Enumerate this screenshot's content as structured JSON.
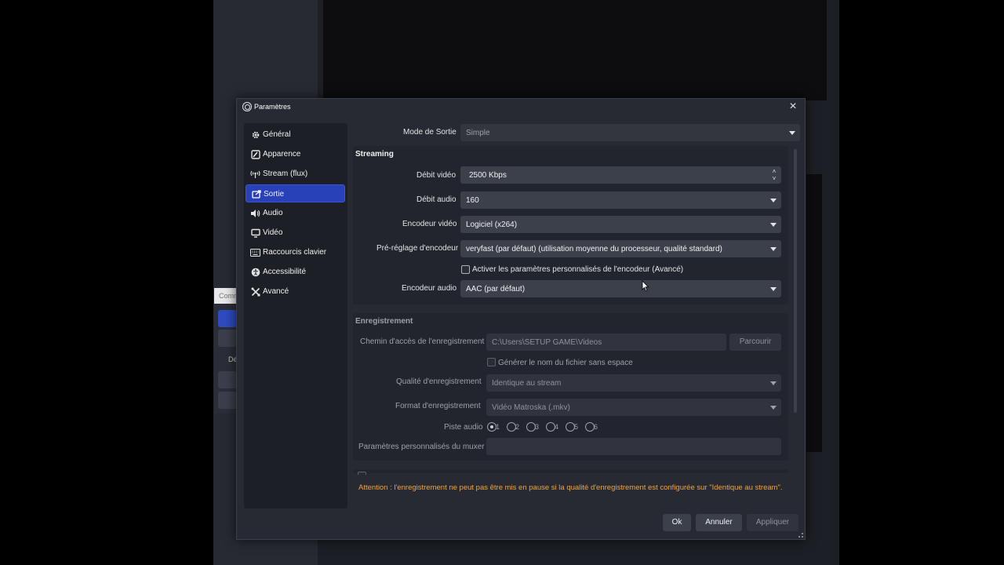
{
  "background": {
    "dock_tab_label": "Comr",
    "dock_label": "Dé"
  },
  "dialog": {
    "title": "Paramètres",
    "close_glyph": "×"
  },
  "sidebar": {
    "items": [
      {
        "label": "Général",
        "icon": "gear-icon"
      },
      {
        "label": "Apparence",
        "icon": "palette-icon"
      },
      {
        "label": "Stream (flux)",
        "icon": "broadcast-icon"
      },
      {
        "label": "Sortie",
        "icon": "output-icon",
        "active": true
      },
      {
        "label": "Audio",
        "icon": "speaker-icon"
      },
      {
        "label": "Vidéo",
        "icon": "monitor-icon"
      },
      {
        "label": "Raccourcis clavier",
        "icon": "keyboard-icon"
      },
      {
        "label": "Accessibilité",
        "icon": "accessibility-icon"
      },
      {
        "label": "Avancé",
        "icon": "tools-icon"
      }
    ]
  },
  "output": {
    "mode_label": "Mode de Sortie",
    "mode_value": "Simple",
    "streaming": {
      "title": "Streaming",
      "video_bitrate_label": "Débit vidéo",
      "video_bitrate_value": "2500 Kbps",
      "audio_bitrate_label": "Débit audio",
      "audio_bitrate_value": "160",
      "video_encoder_label": "Encodeur vidéo",
      "video_encoder_value": "Logiciel (x264)",
      "encoder_preset_label": "Pré-réglage d'encodeur",
      "encoder_preset_value": "veryfast (par défaut) (utilisation moyenne du processeur, qualité standard)",
      "custom_settings_label": "Activer les paramètres personnalisés de l'encodeur (Avancé)",
      "custom_settings_checked": false,
      "audio_encoder_label": "Encodeur audio",
      "audio_encoder_value": "AAC (par défaut)"
    },
    "recording": {
      "title": "Enregistrement",
      "path_label": "Chemin d'accès de l'enregistrement",
      "path_value": "C:\\Users\\SETUP GAME\\Videos",
      "browse_label": "Parcourir",
      "no_space_label": "Générer le nom du fichier sans espace",
      "no_space_checked": false,
      "quality_label": "Qualité d'enregistrement",
      "quality_value": "Identique au stream",
      "format_label": "Format d'enregistrement",
      "format_value": "Vidéo Matroska (.mkv)",
      "audio_track_label": "Piste audio",
      "audio_tracks": [
        "1",
        "2",
        "3",
        "4",
        "5",
        "6"
      ],
      "audio_track_selected": "1",
      "muxer_label": "Paramètres personnalisés du muxer",
      "muxer_value": ""
    },
    "warning": "Attention : l'enregistrement ne peut pas être mis en pause si la qualité d'enregistrement est configurée sur \"Identique au stream\"."
  },
  "buttons": {
    "ok": "Ok",
    "cancel": "Annuler",
    "apply": "Appliquer"
  },
  "colors": {
    "accent": "#2840b8",
    "warning": "#f0a53a",
    "dialog_bg": "#272a33"
  }
}
